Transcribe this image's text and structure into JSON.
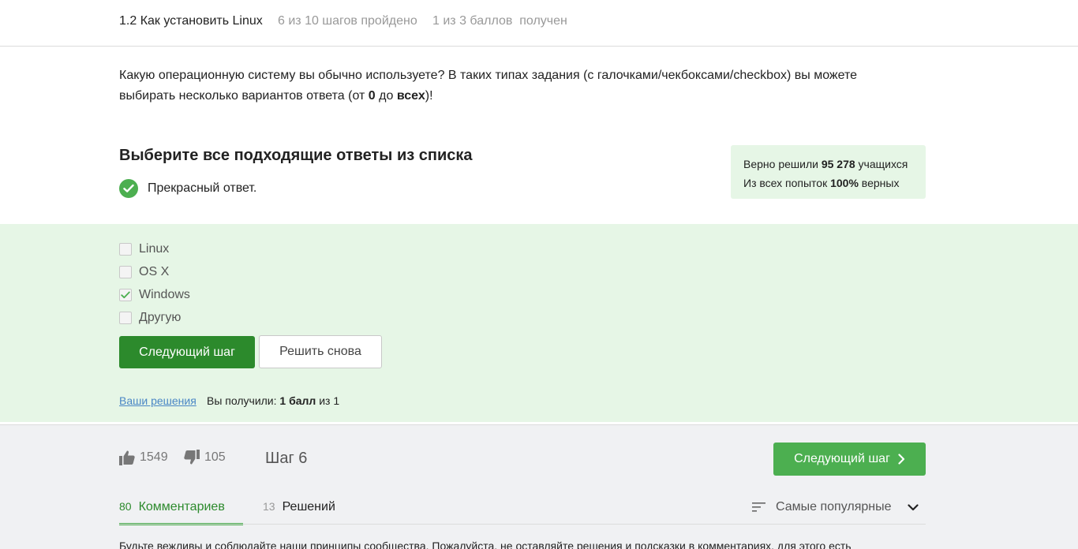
{
  "header": {
    "title": "1.2 Как установить Linux",
    "progress": "6 из 10 шагов пройдено",
    "score": "1 из 3 баллов  получен"
  },
  "question": {
    "line1": "Какую операционную систему вы обычно используете? В таких типах задания (с галочками/чекбоксами/checkbox) вы можете",
    "line2_before": "выбирать несколько вариантов ответа (от ",
    "line2_bold1": "0",
    "line2_mid": " до ",
    "line2_bold2": "всех",
    "line2_after": ")!"
  },
  "task": {
    "title": "Выберите все подходящие ответы из списка",
    "feedback": "Прекрасный ответ."
  },
  "stats": {
    "solved_prefix": "Верно решили ",
    "solved_count": "95 278",
    "solved_suffix": " учащихся",
    "attempts_prefix": "Из всех попыток ",
    "attempts_percent": "100%",
    "attempts_suffix": " верных"
  },
  "options": [
    {
      "label": "Linux",
      "checked": false
    },
    {
      "label": "OS X",
      "checked": false
    },
    {
      "label": "Windows",
      "checked": true
    },
    {
      "label": "Другую",
      "checked": false
    }
  ],
  "buttons": {
    "next": "Следующий шаг",
    "retry": "Решить снова"
  },
  "result": {
    "solutions_link": "Ваши решения",
    "got_prefix": "Вы получили: ",
    "got_bold": "1 балл",
    "got_suffix": " из 1"
  },
  "footer": {
    "likes": "1549",
    "dislikes": "105",
    "step": "Шаг 6",
    "next": "Следующий шаг",
    "tabs": [
      {
        "count": "80",
        "label": "Комментариев"
      },
      {
        "count": "13",
        "label": "Решений"
      }
    ],
    "sort": "Самые популярные",
    "notice": "Будьте вежливы и соблюдайте наши принципы сообщества. Пожалуйста, не оставляйте решения и подсказки в комментариях, для этого есть"
  },
  "colors": {
    "accent": "#4caf50",
    "accent_dark": "#2c8a2c",
    "success_bg": "#e6f6e6",
    "footer_bg": "#f0f1f3",
    "link": "#4a86c5"
  }
}
